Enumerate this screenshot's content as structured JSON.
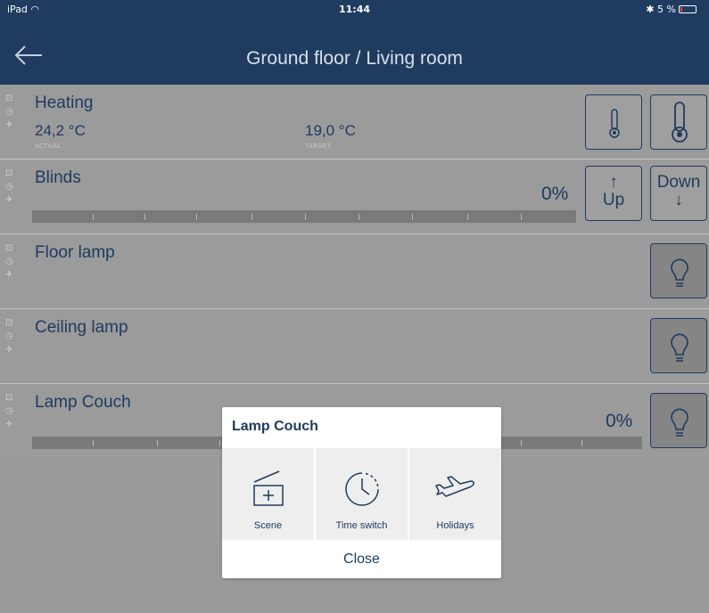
{
  "status": {
    "device": "iPad",
    "time": "11:44",
    "battery": "5 %"
  },
  "header": {
    "title": "Ground floor / Living room"
  },
  "heating": {
    "title": "Heating",
    "actual": "24,2 °C",
    "actual_label": "ACTUAL",
    "target": "19,0 °C",
    "target_label": "TARGET"
  },
  "blinds": {
    "title": "Blinds",
    "percent": "0%",
    "up_label": "Up",
    "down_label": "Down",
    "up_arrow": "↑",
    "down_arrow": "↓"
  },
  "floor_lamp": {
    "title": "Floor lamp"
  },
  "ceiling_lamp": {
    "title": "Ceiling lamp"
  },
  "lamp_couch": {
    "title": "Lamp Couch",
    "percent": "0%"
  },
  "dialog": {
    "title": "Lamp Couch",
    "options": [
      {
        "label": "Scene",
        "icon": "scene-icon"
      },
      {
        "label": "Time switch",
        "icon": "clock-icon"
      },
      {
        "label": "Holidays",
        "icon": "airplane-icon"
      }
    ],
    "close_label": "Close"
  },
  "colors": {
    "navy": "#1f3b60",
    "overlay": "#9b9b9b"
  }
}
